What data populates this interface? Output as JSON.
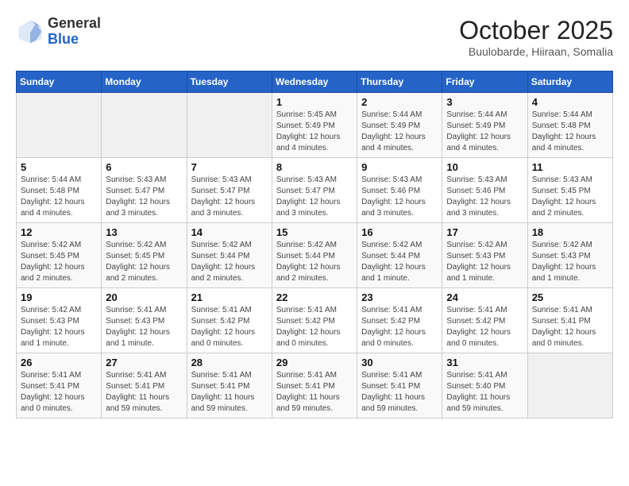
{
  "header": {
    "logo_general": "General",
    "logo_blue": "Blue",
    "month_title": "October 2025",
    "subtitle": "Buulobarde, Hiiraan, Somalia"
  },
  "weekdays": [
    "Sunday",
    "Monday",
    "Tuesday",
    "Wednesday",
    "Thursday",
    "Friday",
    "Saturday"
  ],
  "weeks": [
    [
      {
        "day": "",
        "sunrise": "",
        "sunset": "",
        "daylight": ""
      },
      {
        "day": "",
        "sunrise": "",
        "sunset": "",
        "daylight": ""
      },
      {
        "day": "",
        "sunrise": "",
        "sunset": "",
        "daylight": ""
      },
      {
        "day": "1",
        "sunrise": "Sunrise: 5:45 AM",
        "sunset": "Sunset: 5:49 PM",
        "daylight": "Daylight: 12 hours and 4 minutes."
      },
      {
        "day": "2",
        "sunrise": "Sunrise: 5:44 AM",
        "sunset": "Sunset: 5:49 PM",
        "daylight": "Daylight: 12 hours and 4 minutes."
      },
      {
        "day": "3",
        "sunrise": "Sunrise: 5:44 AM",
        "sunset": "Sunset: 5:49 PM",
        "daylight": "Daylight: 12 hours and 4 minutes."
      },
      {
        "day": "4",
        "sunrise": "Sunrise: 5:44 AM",
        "sunset": "Sunset: 5:48 PM",
        "daylight": "Daylight: 12 hours and 4 minutes."
      }
    ],
    [
      {
        "day": "5",
        "sunrise": "Sunrise: 5:44 AM",
        "sunset": "Sunset: 5:48 PM",
        "daylight": "Daylight: 12 hours and 4 minutes."
      },
      {
        "day": "6",
        "sunrise": "Sunrise: 5:43 AM",
        "sunset": "Sunset: 5:47 PM",
        "daylight": "Daylight: 12 hours and 3 minutes."
      },
      {
        "day": "7",
        "sunrise": "Sunrise: 5:43 AM",
        "sunset": "Sunset: 5:47 PM",
        "daylight": "Daylight: 12 hours and 3 minutes."
      },
      {
        "day": "8",
        "sunrise": "Sunrise: 5:43 AM",
        "sunset": "Sunset: 5:47 PM",
        "daylight": "Daylight: 12 hours and 3 minutes."
      },
      {
        "day": "9",
        "sunrise": "Sunrise: 5:43 AM",
        "sunset": "Sunset: 5:46 PM",
        "daylight": "Daylight: 12 hours and 3 minutes."
      },
      {
        "day": "10",
        "sunrise": "Sunrise: 5:43 AM",
        "sunset": "Sunset: 5:46 PM",
        "daylight": "Daylight: 12 hours and 3 minutes."
      },
      {
        "day": "11",
        "sunrise": "Sunrise: 5:43 AM",
        "sunset": "Sunset: 5:45 PM",
        "daylight": "Daylight: 12 hours and 2 minutes."
      }
    ],
    [
      {
        "day": "12",
        "sunrise": "Sunrise: 5:42 AM",
        "sunset": "Sunset: 5:45 PM",
        "daylight": "Daylight: 12 hours and 2 minutes."
      },
      {
        "day": "13",
        "sunrise": "Sunrise: 5:42 AM",
        "sunset": "Sunset: 5:45 PM",
        "daylight": "Daylight: 12 hours and 2 minutes."
      },
      {
        "day": "14",
        "sunrise": "Sunrise: 5:42 AM",
        "sunset": "Sunset: 5:44 PM",
        "daylight": "Daylight: 12 hours and 2 minutes."
      },
      {
        "day": "15",
        "sunrise": "Sunrise: 5:42 AM",
        "sunset": "Sunset: 5:44 PM",
        "daylight": "Daylight: 12 hours and 2 minutes."
      },
      {
        "day": "16",
        "sunrise": "Sunrise: 5:42 AM",
        "sunset": "Sunset: 5:44 PM",
        "daylight": "Daylight: 12 hours and 1 minute."
      },
      {
        "day": "17",
        "sunrise": "Sunrise: 5:42 AM",
        "sunset": "Sunset: 5:43 PM",
        "daylight": "Daylight: 12 hours and 1 minute."
      },
      {
        "day": "18",
        "sunrise": "Sunrise: 5:42 AM",
        "sunset": "Sunset: 5:43 PM",
        "daylight": "Daylight: 12 hours and 1 minute."
      }
    ],
    [
      {
        "day": "19",
        "sunrise": "Sunrise: 5:42 AM",
        "sunset": "Sunset: 5:43 PM",
        "daylight": "Daylight: 12 hours and 1 minute."
      },
      {
        "day": "20",
        "sunrise": "Sunrise: 5:41 AM",
        "sunset": "Sunset: 5:43 PM",
        "daylight": "Daylight: 12 hours and 1 minute."
      },
      {
        "day": "21",
        "sunrise": "Sunrise: 5:41 AM",
        "sunset": "Sunset: 5:42 PM",
        "daylight": "Daylight: 12 hours and 0 minutes."
      },
      {
        "day": "22",
        "sunrise": "Sunrise: 5:41 AM",
        "sunset": "Sunset: 5:42 PM",
        "daylight": "Daylight: 12 hours and 0 minutes."
      },
      {
        "day": "23",
        "sunrise": "Sunrise: 5:41 AM",
        "sunset": "Sunset: 5:42 PM",
        "daylight": "Daylight: 12 hours and 0 minutes."
      },
      {
        "day": "24",
        "sunrise": "Sunrise: 5:41 AM",
        "sunset": "Sunset: 5:42 PM",
        "daylight": "Daylight: 12 hours and 0 minutes."
      },
      {
        "day": "25",
        "sunrise": "Sunrise: 5:41 AM",
        "sunset": "Sunset: 5:41 PM",
        "daylight": "Daylight: 12 hours and 0 minutes."
      }
    ],
    [
      {
        "day": "26",
        "sunrise": "Sunrise: 5:41 AM",
        "sunset": "Sunset: 5:41 PM",
        "daylight": "Daylight: 12 hours and 0 minutes."
      },
      {
        "day": "27",
        "sunrise": "Sunrise: 5:41 AM",
        "sunset": "Sunset: 5:41 PM",
        "daylight": "Daylight: 11 hours and 59 minutes."
      },
      {
        "day": "28",
        "sunrise": "Sunrise: 5:41 AM",
        "sunset": "Sunset: 5:41 PM",
        "daylight": "Daylight: 11 hours and 59 minutes."
      },
      {
        "day": "29",
        "sunrise": "Sunrise: 5:41 AM",
        "sunset": "Sunset: 5:41 PM",
        "daylight": "Daylight: 11 hours and 59 minutes."
      },
      {
        "day": "30",
        "sunrise": "Sunrise: 5:41 AM",
        "sunset": "Sunset: 5:41 PM",
        "daylight": "Daylight: 11 hours and 59 minutes."
      },
      {
        "day": "31",
        "sunrise": "Sunrise: 5:41 AM",
        "sunset": "Sunset: 5:40 PM",
        "daylight": "Daylight: 11 hours and 59 minutes."
      },
      {
        "day": "",
        "sunrise": "",
        "sunset": "",
        "daylight": ""
      }
    ]
  ]
}
